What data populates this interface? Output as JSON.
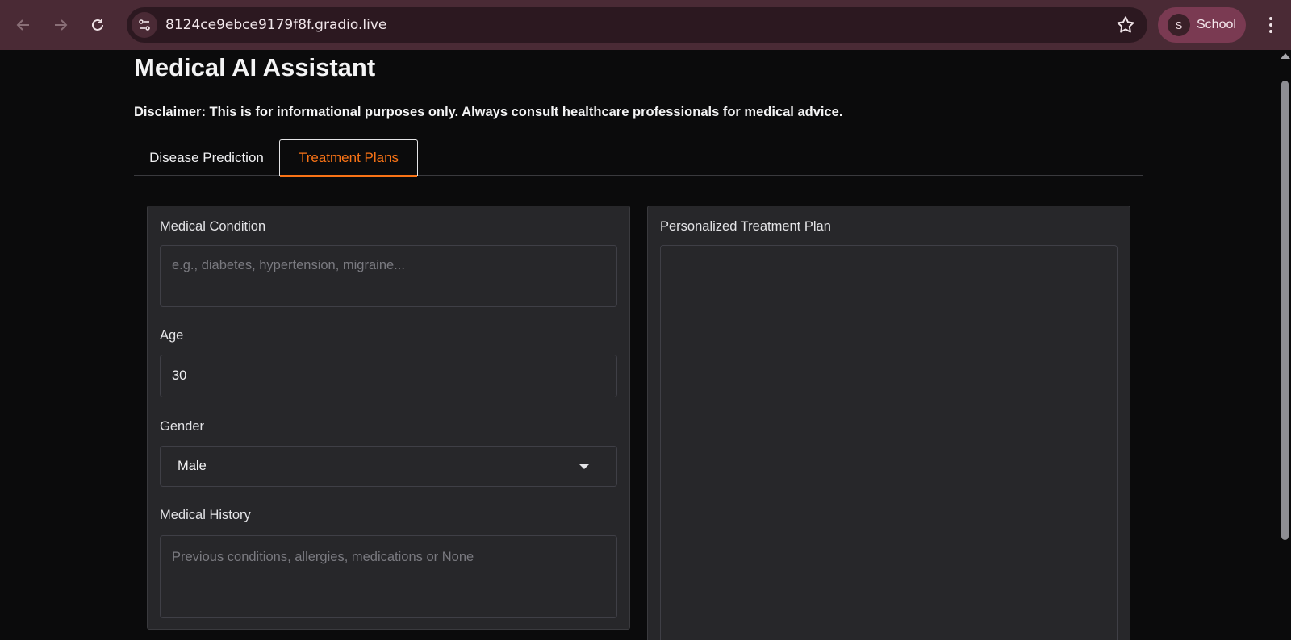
{
  "browser": {
    "url": "8124ce9ebce9179f8f.gradio.live",
    "profile_initial": "S",
    "profile_name": "School",
    "icons": [
      "back-arrow-icon",
      "forward-arrow-icon",
      "reload-icon",
      "site-info-icon",
      "star-icon",
      "kebab-menu-icon"
    ],
    "accent_color": "#4a2a35"
  },
  "app": {
    "title": "Medical AI Assistant",
    "disclaimer": "Disclaimer: This is for informational purposes only. Always consult healthcare professionals for medical advice.",
    "tabs": [
      {
        "label": "Disease Prediction",
        "selected": false
      },
      {
        "label": "Treatment Plans",
        "selected": true
      }
    ],
    "accent_color": "#f97316"
  },
  "form": {
    "condition_label": "Medical Condition",
    "condition_placeholder": "e.g., diabetes, hypertension, migraine...",
    "age_label": "Age",
    "age_value": "30",
    "gender_label": "Gender",
    "gender_value": "Male",
    "history_label": "Medical History",
    "history_placeholder": "Previous conditions, allergies, medications or None"
  },
  "output": {
    "label": "Personalized Treatment Plan",
    "value": ""
  }
}
